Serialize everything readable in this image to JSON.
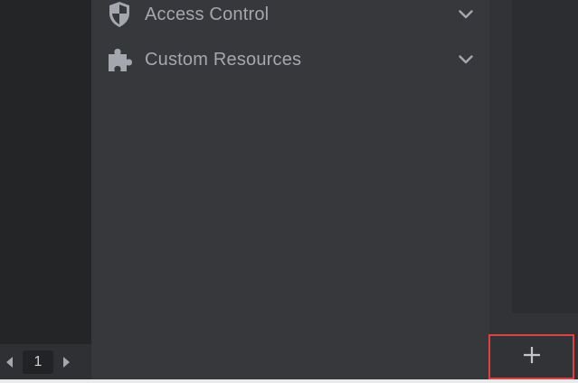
{
  "nav": {
    "items": [
      {
        "label": "Access Control",
        "icon": "shield-icon",
        "expanded": false
      },
      {
        "label": "Custom Resources",
        "icon": "puzzle-icon",
        "expanded": false
      }
    ]
  },
  "pager": {
    "current_page": "1"
  },
  "add_button": {
    "icon": "plus-icon"
  },
  "colors": {
    "panel": "#36383c",
    "label": "#a4a7ad",
    "highlight": "#e0403f"
  }
}
